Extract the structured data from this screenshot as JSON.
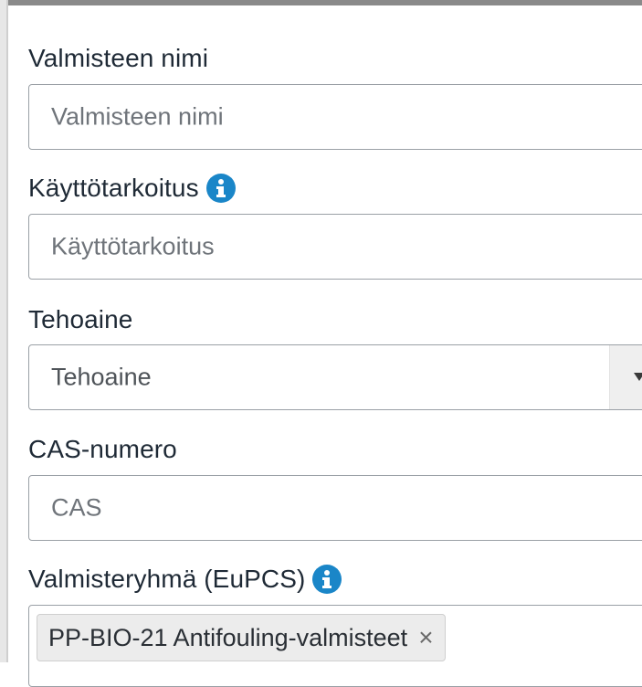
{
  "form": {
    "product_name": {
      "label": "Valmisteen nimi",
      "placeholder": "Valmisteen nimi"
    },
    "intended_use": {
      "label": "Käyttötarkoitus",
      "placeholder": "Käyttötarkoitus",
      "info_icon": "info-circle-icon"
    },
    "active_substance": {
      "label": "Tehoaine",
      "selected": "Tehoaine",
      "dropdown_icon": "caret-down-icon"
    },
    "cas_number": {
      "label": "CAS-numero",
      "placeholder": "CAS"
    },
    "product_group": {
      "label": "Valmisteryhmä (EuPCS)",
      "info_icon": "info-circle-icon",
      "tags": [
        {
          "text": "PP-BIO-21 Antifouling-valmisteet",
          "remove": "×"
        }
      ]
    }
  },
  "colors": {
    "info_icon": "#1a86c8",
    "border": "#9aa0a6",
    "label_text": "#1f2a36",
    "placeholder_text": "#6f747a",
    "tag_bg": "#ececec"
  }
}
